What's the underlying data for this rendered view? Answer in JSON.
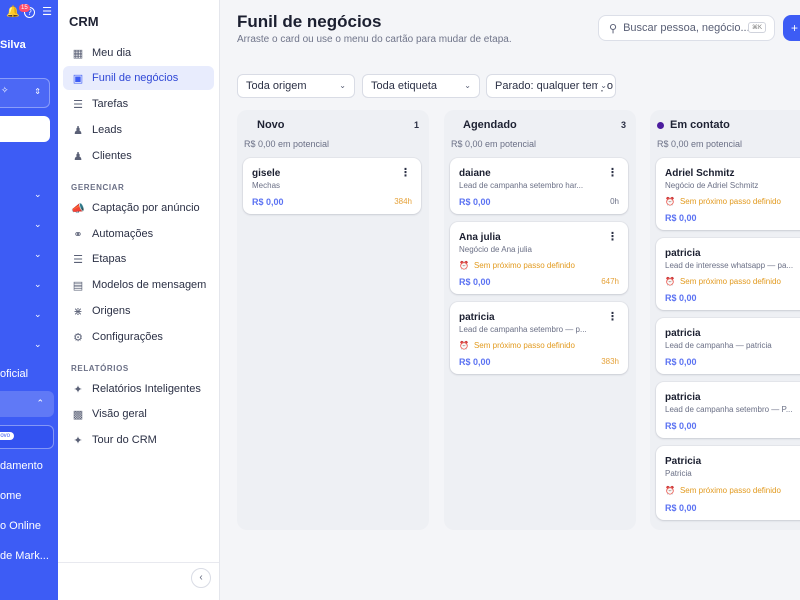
{
  "rail": {
    "notification_count": "15",
    "user_name": "Silva",
    "items": [
      "oficial",
      "damento",
      "ome",
      "o Online",
      "de Mark..."
    ],
    "novo_badge": "novo"
  },
  "sidebar": {
    "title": "CRM",
    "items": [
      {
        "label": "Meu dia",
        "icon": "grid-icon"
      },
      {
        "label": "Funil de negócios",
        "icon": "funnel-board-icon"
      },
      {
        "label": "Tarefas",
        "icon": "checklist-icon"
      },
      {
        "label": "Leads",
        "icon": "users-icon"
      },
      {
        "label": "Clientes",
        "icon": "user-check-icon"
      }
    ],
    "section_manage": "GERENCIAR",
    "manage_items": [
      {
        "label": "Captação por anúncio",
        "icon": "megaphone-icon"
      },
      {
        "label": "Automações",
        "icon": "automation-icon"
      },
      {
        "label": "Etapas",
        "icon": "layers-icon"
      },
      {
        "label": "Modelos de mensagem",
        "icon": "message-template-icon"
      },
      {
        "label": "Origens",
        "icon": "broadcast-icon"
      },
      {
        "label": "Configurações",
        "icon": "gear-icon"
      }
    ],
    "section_reports": "RELATÓRIOS",
    "report_items": [
      {
        "label": "Relatórios Inteligentes",
        "icon": "sparkle-icon"
      },
      {
        "label": "Visão geral",
        "icon": "bar-chart-icon"
      },
      {
        "label": "Tour do CRM",
        "icon": "sparkle-icon"
      }
    ]
  },
  "header": {
    "title": "Funil de negócios",
    "subtitle": "Arraste o card ou use o menu do cartão para mudar de etapa.",
    "search_placeholder": "Buscar pessoa, negócio...",
    "search_shortcut": "⌘K",
    "add_label": "+"
  },
  "filters": {
    "origin": "Toda origem",
    "tag": "Toda etiqueta",
    "stopped": "Parado: qualquer tempo"
  },
  "columns": [
    {
      "title": "Novo",
      "count": "1",
      "potential": "R$ 0,00 em potencial",
      "cards": [
        {
          "name": "gisele",
          "sub": "Mechas",
          "value": "R$ 0,00",
          "time": "384h"
        }
      ]
    },
    {
      "title": "Agendado",
      "count": "3",
      "potential": "R$ 0,00 em potencial",
      "cards": [
        {
          "name": "daiane",
          "sub": "Lead de campanha setembro har...",
          "value": "R$ 0,00",
          "time": "0h"
        },
        {
          "name": "Ana julia",
          "sub": "Negócio de Ana julia",
          "warning": "Sem próximo passo definido",
          "value": "R$ 0,00",
          "time": "647h"
        },
        {
          "name": "patricia",
          "sub": "Lead de campanha setembro — p...",
          "warning": "Sem próximo passo definido",
          "value": "R$ 0,00",
          "time": "383h"
        }
      ]
    },
    {
      "title": "Em contato",
      "potential": "R$ 0,00 em potencial",
      "cards": [
        {
          "name": "Adriel Schmitz",
          "sub": "Negócio de Adriel Schmitz",
          "warning": "Sem próximo passo definido",
          "value": "R$ 0,00"
        },
        {
          "name": "patricia",
          "sub": "Lead de interesse whatsapp — pa...",
          "warning": "Sem próximo passo definido",
          "value": "R$ 0,00"
        },
        {
          "name": "patricia",
          "sub": "Lead de campanha — patricia",
          "value": "R$ 0,00"
        },
        {
          "name": "patricia",
          "sub": "Lead de campanha setembro — P...",
          "value": "R$ 0,00"
        },
        {
          "name": "Patricia",
          "sub": "Patricia",
          "warning": "Sem próximo passo definido",
          "value": "R$ 0,00"
        }
      ]
    }
  ]
}
